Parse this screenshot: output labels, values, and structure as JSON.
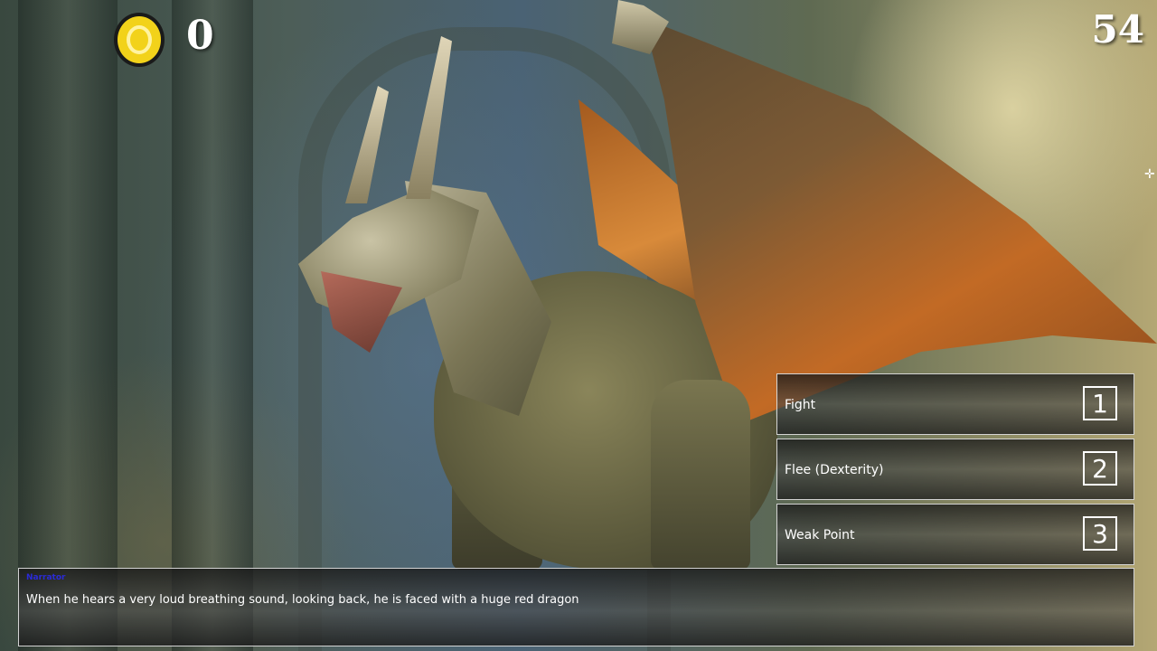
{
  "hud": {
    "coin_count": "0",
    "timer": "54",
    "coin_color": "#f2d21a",
    "coin_outline_color": "#1a1a1a"
  },
  "choices": [
    {
      "label": "Fight",
      "key": "1"
    },
    {
      "label": "Flee (Dexterity)",
      "key": "2"
    },
    {
      "label": "Weak Point",
      "key": "3"
    }
  ],
  "dialogue": {
    "speaker": "Narrator",
    "speaker_color": "#2a2ad8",
    "text": "When he hears a very loud breathing sound, looking back, he is faced with a huge red dragon"
  },
  "scene": {
    "icons": [
      "coin-icon",
      "crosshair-icon"
    ]
  }
}
